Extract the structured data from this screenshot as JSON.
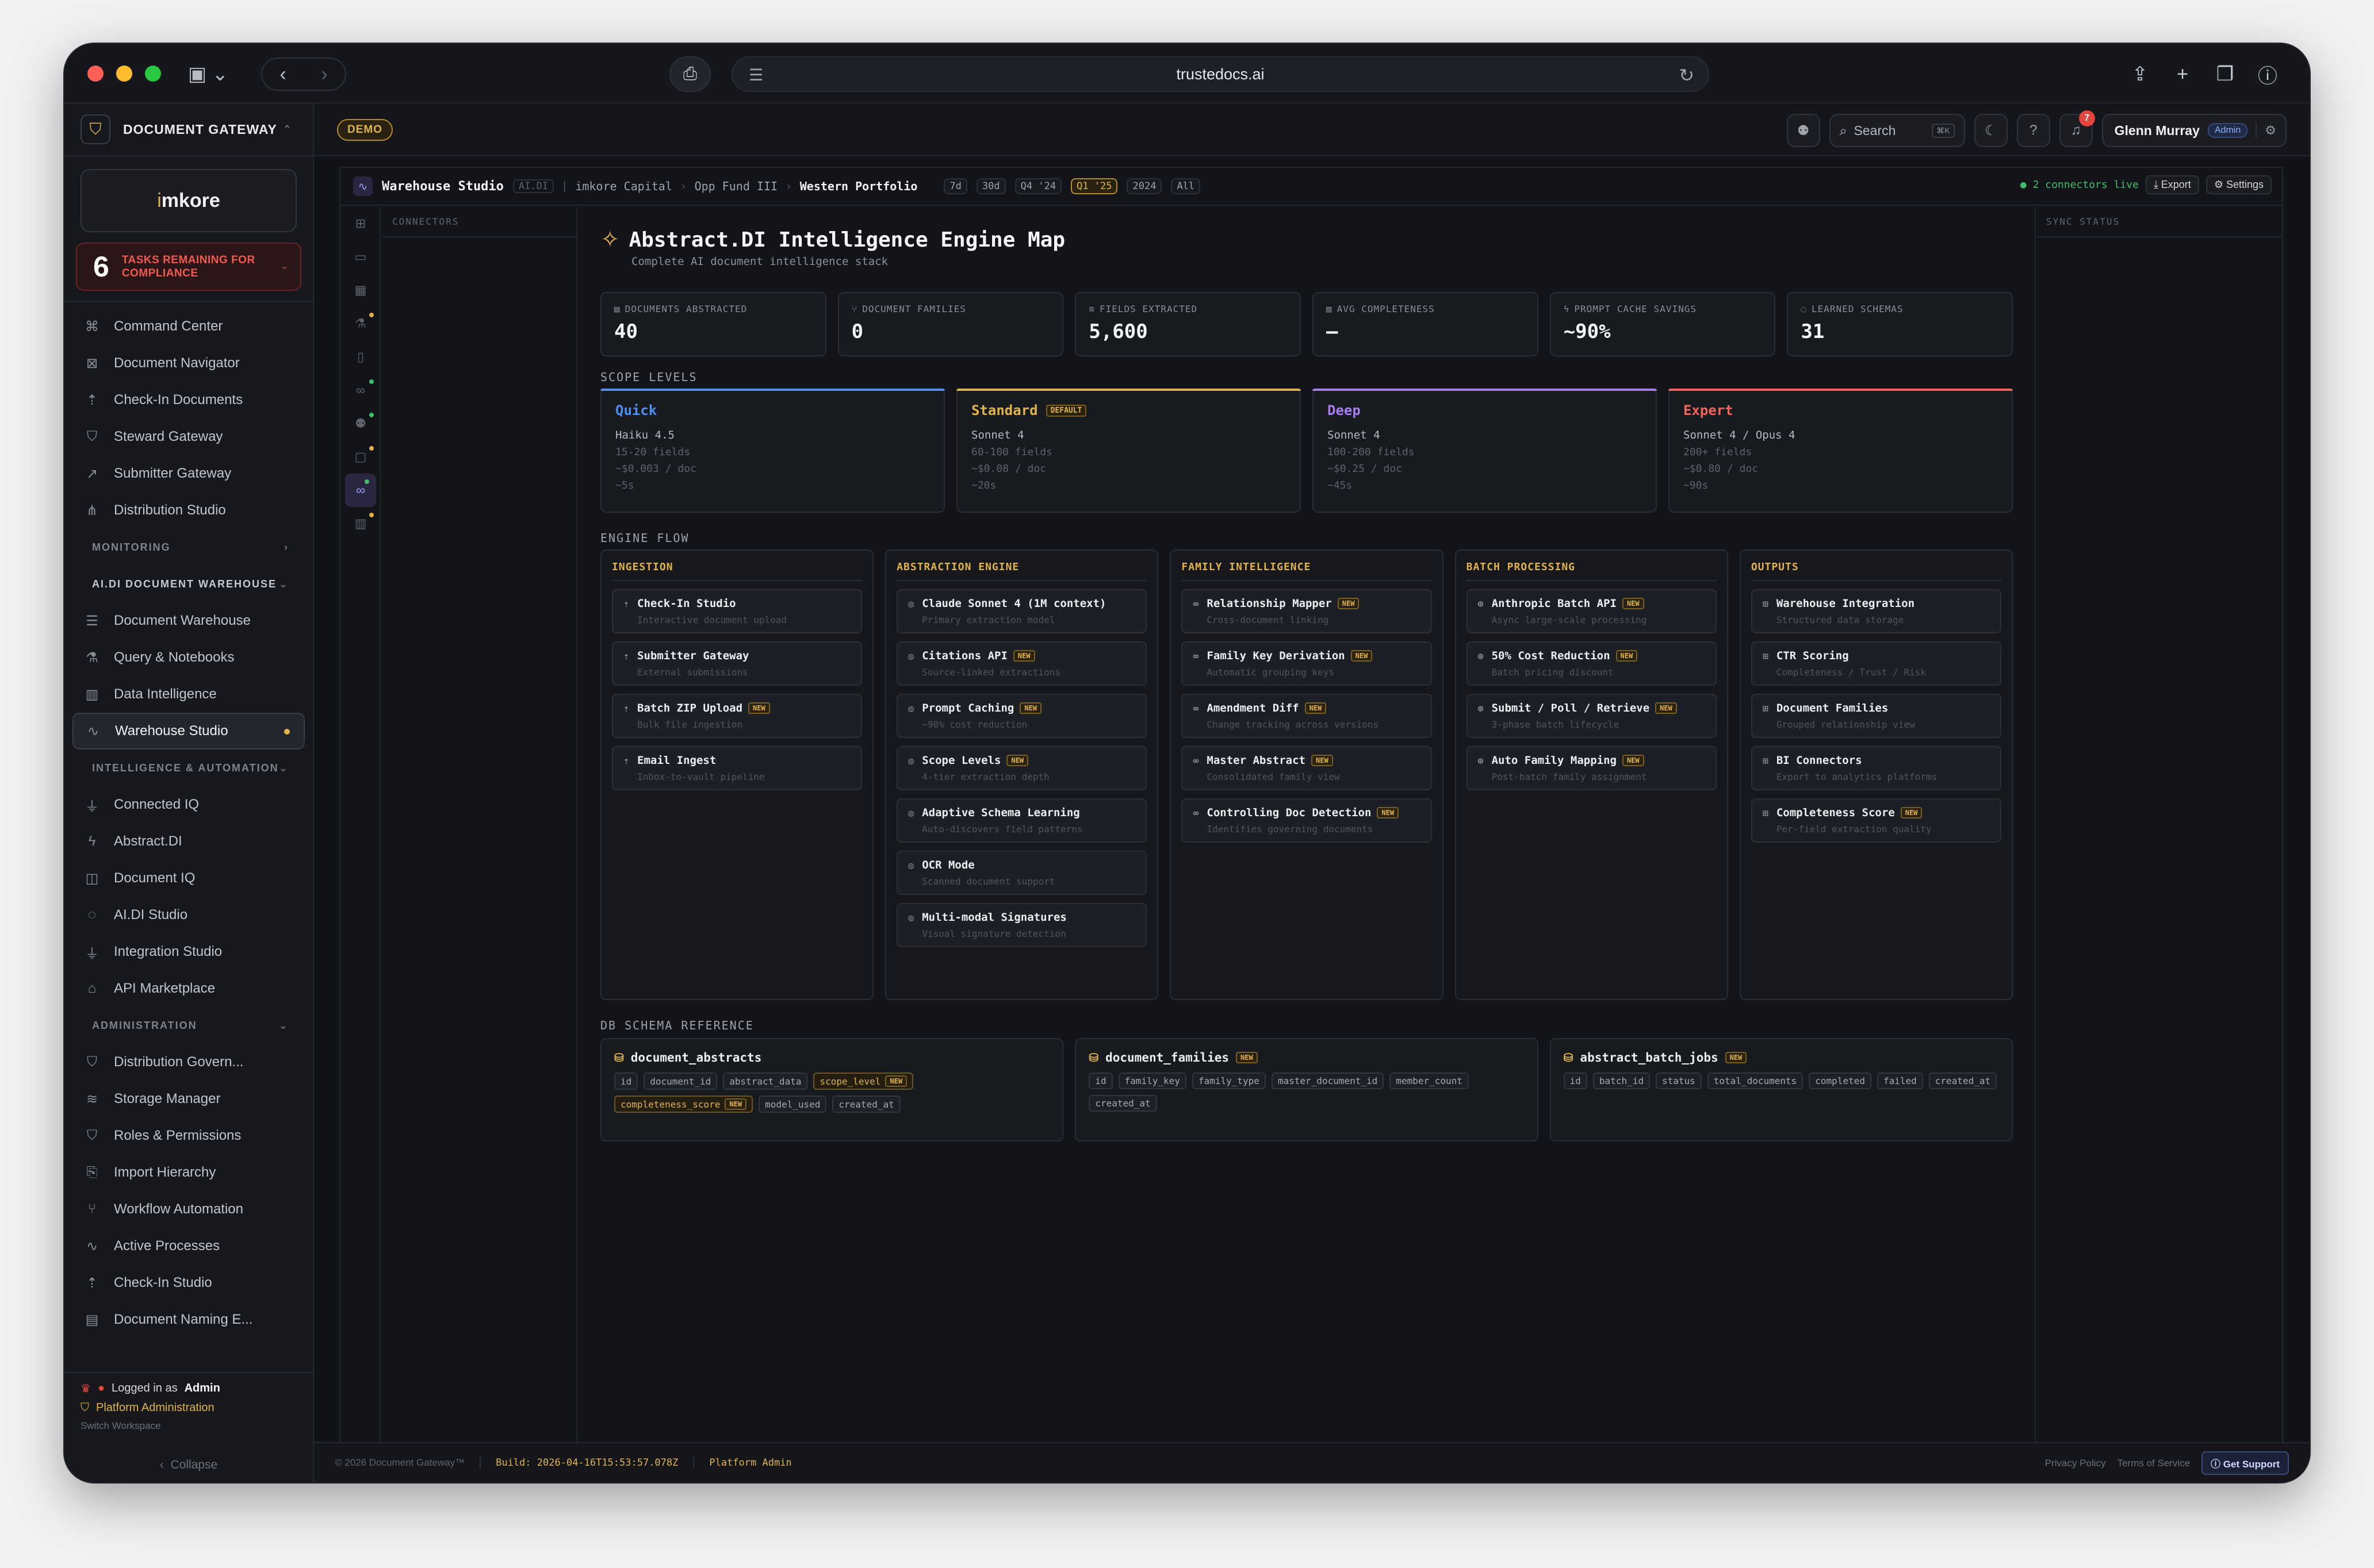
{
  "browser": {
    "url": "trustedocs.ai"
  },
  "sidebar": {
    "brand": "DOCUMENT GATEWAY",
    "logo_prefix": "i",
    "logo_text": "mkore",
    "tasks_count": "6",
    "tasks_text_1": "TASKS REMAINING FOR",
    "tasks_text_2": "COMPLIANCE",
    "top_items": [
      {
        "label": "Command Center",
        "icon": "command-icon"
      },
      {
        "label": "Document Navigator",
        "icon": "navigator-icon"
      },
      {
        "label": "Check-In Documents",
        "icon": "upload-icon"
      },
      {
        "label": "Steward Gateway",
        "icon": "shield-icon"
      },
      {
        "label": "Submitter Gateway",
        "icon": "external-link-icon"
      },
      {
        "label": "Distribution Studio",
        "icon": "share-icon"
      }
    ],
    "section_monitoring": "MONITORING",
    "section_warehouse": "AI.DI DOCUMENT WAREHOUSE",
    "warehouse_items": [
      {
        "label": "Document Warehouse"
      },
      {
        "label": "Query & Notebooks"
      },
      {
        "label": "Data Intelligence"
      },
      {
        "label": "Warehouse Studio"
      }
    ],
    "section_intel": "INTELLIGENCE & AUTOMATION",
    "intel_items": [
      {
        "label": "Connected IQ"
      },
      {
        "label": "Abstract.DI"
      },
      {
        "label": "Document IQ"
      },
      {
        "label": "AI.DI Studio"
      },
      {
        "label": "Integration Studio"
      },
      {
        "label": "API Marketplace"
      }
    ],
    "section_admin": "ADMINISTRATION",
    "admin_items": [
      {
        "label": "Distribution Govern..."
      },
      {
        "label": "Storage Manager"
      },
      {
        "label": "Roles & Permissions"
      },
      {
        "label": "Import Hierarchy"
      },
      {
        "label": "Workflow Automation"
      },
      {
        "label": "Active Processes"
      },
      {
        "label": "Check-In Studio"
      },
      {
        "label": "Document Naming E..."
      }
    ],
    "logged_in_prefix": "Logged in as",
    "logged_in_role": "Admin",
    "platform_admin": "Platform Administration",
    "switch_workspace": "Switch Workspace",
    "collapse": "Collapse"
  },
  "topbar": {
    "demo": "DEMO",
    "search": "Search",
    "search_kbd": "⌘K",
    "notif_count": "7",
    "user_name": "Glenn Murray",
    "user_role": "Admin"
  },
  "workspace": {
    "title": "Warehouse Studio",
    "tag": "AI.DI",
    "crumbs": [
      "imkore Capital",
      "Opp Fund III",
      "Western Portfolio"
    ],
    "ranges": [
      "7d",
      "30d",
      "Q4 '24",
      "Q1 '25",
      "2024",
      "All"
    ],
    "active_range": "Q1 '25",
    "connectors_live": "2 connectors live",
    "export": "Export",
    "settings": "Settings",
    "connectors_label": "CONNECTORS",
    "sync_label": "SYNC STATUS"
  },
  "main": {
    "title": "Abstract.DI Intelligence Engine Map",
    "subtitle": "Complete AI document intelligence stack",
    "stats": [
      {
        "label": "DOCUMENTS ABSTRACTED",
        "value": "40"
      },
      {
        "label": "DOCUMENT FAMILIES",
        "value": "0"
      },
      {
        "label": "FIELDS EXTRACTED",
        "value": "5,600"
      },
      {
        "label": "AVG COMPLETENESS",
        "value": "—"
      },
      {
        "label": "PROMPT CACHE SAVINGS",
        "value": "~90%"
      },
      {
        "label": "LEARNED SCHEMAS",
        "value": "31"
      }
    ],
    "scope_label": "SCOPE LEVELS",
    "scopes": [
      {
        "name": "Quick",
        "model": "Haiku 4.5",
        "fields": "15-20 fields",
        "cost": "~$0.003 / doc",
        "time": "~5s",
        "color": "#4f8ff0"
      },
      {
        "name": "Standard",
        "badge": "DEFAULT",
        "model": "Sonnet 4",
        "fields": "60-100 fields",
        "cost": "~$0.08 / doc",
        "time": "~20s",
        "color": "#e1b34a"
      },
      {
        "name": "Deep",
        "model": "Sonnet 4",
        "fields": "100-200 fields",
        "cost": "~$0.25 / doc",
        "time": "~45s",
        "color": "#a77cf0"
      },
      {
        "name": "Expert",
        "model": "Sonnet 4 / Opus 4",
        "fields": "200+ fields",
        "cost": "~$0.80 / doc",
        "time": "~90s",
        "color": "#f0645a"
      }
    ],
    "flow_label": "ENGINE FLOW",
    "new_label": "NEW",
    "columns": [
      {
        "title": "INGESTION",
        "nodes": [
          {
            "name": "Check-In Studio",
            "desc": "Interactive document upload"
          },
          {
            "name": "Submitter Gateway",
            "desc": "External submissions"
          },
          {
            "name": "Batch ZIP Upload",
            "desc": "Bulk file ingestion",
            "new": true
          },
          {
            "name": "Email Ingest",
            "desc": "Inbox-to-vault pipeline"
          }
        ]
      },
      {
        "title": "ABSTRACTION ENGINE",
        "nodes": [
          {
            "name": "Claude Sonnet 4 (1M context)",
            "desc": "Primary extraction model"
          },
          {
            "name": "Citations API",
            "desc": "Source-linked extractions",
            "new": true
          },
          {
            "name": "Prompt Caching",
            "desc": "~90% cost reduction",
            "new": true
          },
          {
            "name": "Scope Levels",
            "desc": "4-tier extraction depth",
            "new": true
          },
          {
            "name": "Adaptive Schema Learning",
            "desc": "Auto-discovers field patterns"
          },
          {
            "name": "OCR Mode",
            "desc": "Scanned document support"
          },
          {
            "name": "Multi-modal Signatures",
            "desc": "Visual signature detection"
          }
        ]
      },
      {
        "title": "FAMILY INTELLIGENCE",
        "nodes": [
          {
            "name": "Relationship Mapper",
            "desc": "Cross-document linking",
            "new": true
          },
          {
            "name": "Family Key Derivation",
            "desc": "Automatic grouping keys",
            "new": true
          },
          {
            "name": "Amendment Diff",
            "desc": "Change tracking across versions",
            "new": true
          },
          {
            "name": "Master Abstract",
            "desc": "Consolidated family view",
            "new": true
          },
          {
            "name": "Controlling Doc Detection",
            "desc": "Identifies governing documents",
            "new": true
          }
        ]
      },
      {
        "title": "BATCH PROCESSING",
        "nodes": [
          {
            "name": "Anthropic Batch API",
            "desc": "Async large-scale processing",
            "new": true
          },
          {
            "name": "50% Cost Reduction",
            "desc": "Batch pricing discount",
            "new": true
          },
          {
            "name": "Submit / Poll / Retrieve",
            "desc": "3-phase batch lifecycle",
            "new": true
          },
          {
            "name": "Auto Family Mapping",
            "desc": "Post-batch family assignment",
            "new": true
          }
        ]
      },
      {
        "title": "OUTPUTS",
        "nodes": [
          {
            "name": "Warehouse Integration",
            "desc": "Structured data storage"
          },
          {
            "name": "CTR Scoring",
            "desc": "Completeness / Trust / Risk"
          },
          {
            "name": "Document Families",
            "desc": "Grouped relationship view"
          },
          {
            "name": "BI Connectors",
            "desc": "Export to analytics platforms"
          },
          {
            "name": "Completeness Score",
            "desc": "Per-field extraction quality",
            "new": true
          }
        ]
      }
    ],
    "schema_label": "DB SCHEMA REFERENCE",
    "schemas": [
      {
        "name": "document_abstracts",
        "new": false,
        "fields": [
          {
            "f": "id"
          },
          {
            "f": "document_id"
          },
          {
            "f": "abstract_data"
          },
          {
            "f": "scope_level",
            "new": true
          },
          {
            "f": "completeness_score",
            "new": true
          },
          {
            "f": "model_used"
          },
          {
            "f": "created_at"
          }
        ]
      },
      {
        "name": "document_families",
        "new": true,
        "fields": [
          {
            "f": "id"
          },
          {
            "f": "family_key"
          },
          {
            "f": "family_type"
          },
          {
            "f": "master_document_id"
          },
          {
            "f": "member_count"
          },
          {
            "f": "created_at"
          }
        ]
      },
      {
        "name": "abstract_batch_jobs",
        "new": true,
        "fields": [
          {
            "f": "id"
          },
          {
            "f": "batch_id"
          },
          {
            "f": "status"
          },
          {
            "f": "total_documents"
          },
          {
            "f": "completed"
          },
          {
            "f": "failed"
          },
          {
            "f": "created_at"
          }
        ]
      }
    ]
  },
  "footer": {
    "copyright": "© 2026 Document Gateway™",
    "build": "Build: 2026-04-16T15:53:57.078Z",
    "platform": "Platform Admin",
    "privacy": "Privacy Policy",
    "terms": "Terms of Service",
    "support": "Get Support"
  }
}
